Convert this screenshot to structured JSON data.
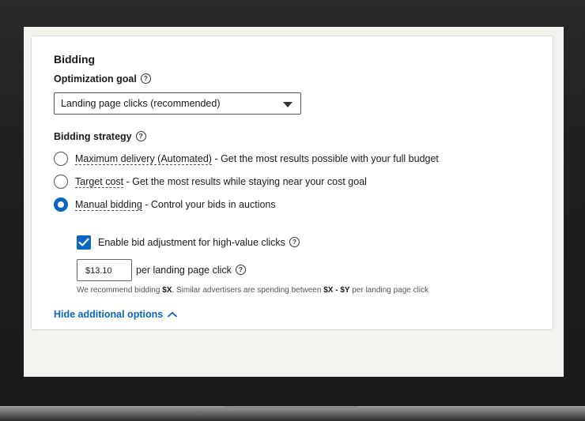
{
  "bidding": {
    "section_title": "Bidding",
    "optimization_goal": {
      "label": "Optimization goal",
      "help_icon": "question-circle-icon",
      "selected_value": "Landing page clicks (recommended)"
    },
    "strategy": {
      "label": "Bidding strategy",
      "help_icon": "question-circle-icon",
      "options": [
        {
          "name": "Maximum delivery (Automated)",
          "description": " - Get the most results possible with your full budget",
          "selected": false
        },
        {
          "name": "Target cost",
          "description": " - Get the most results while staying near your cost goal",
          "selected": false
        },
        {
          "name": "Manual bidding",
          "description": " - Control your bids in auctions",
          "selected": true
        }
      ]
    },
    "bid_adjustment": {
      "label": "Enable bid adjustment for high-value clicks",
      "checked": true
    },
    "bid": {
      "value": "$13.10",
      "suffix": "per landing page click"
    },
    "recommendation": {
      "prefix": "We recommend bidding ",
      "amount": "$X",
      "middle": ". Similar advertisers are spending between ",
      "range": "$X - $Y",
      "suffix": " per landing page click"
    },
    "hide_options_label": "Hide additional options"
  },
  "colors": {
    "accent": "#0a66c2",
    "screen_bg": "#f3f2ef",
    "card_bg": "#ffffff",
    "device_frame": "#1c1c1c"
  }
}
